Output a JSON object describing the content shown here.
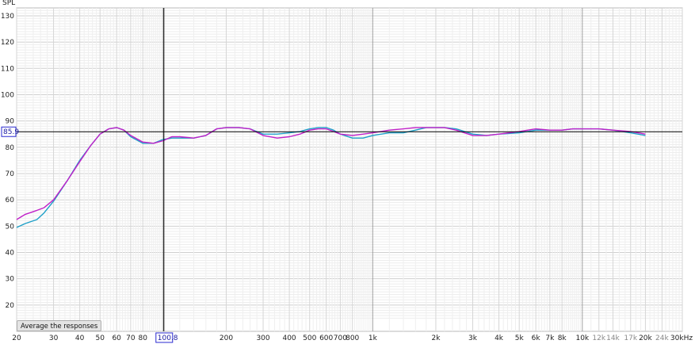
{
  "toolbar": {
    "average_label": "Average the responses"
  },
  "cursor": {
    "spl_readout": "85.9",
    "freq_readout": "100.8",
    "spl_value": 85.9,
    "freq_value": 100.8
  },
  "colors": {
    "series_a": "#1ea0c8",
    "series_b": "#c020c8",
    "cursor": "#000000"
  },
  "chart_data": {
    "type": "line",
    "ylabel": "SPL",
    "xscale": "log",
    "xlim": [
      20,
      30000
    ],
    "ylim": [
      10,
      133
    ],
    "grid": true,
    "x_ticks": [
      {
        "v": 20,
        "label": "20"
      },
      {
        "v": 30,
        "label": "30"
      },
      {
        "v": 40,
        "label": "40"
      },
      {
        "v": 50,
        "label": "50"
      },
      {
        "v": 60,
        "label": "60"
      },
      {
        "v": 70,
        "label": "70"
      },
      {
        "v": 80,
        "label": "80"
      },
      {
        "v": 200,
        "label": "200"
      },
      {
        "v": 300,
        "label": "300"
      },
      {
        "v": 400,
        "label": "400"
      },
      {
        "v": 500,
        "label": "500"
      },
      {
        "v": 600,
        "label": "600"
      },
      {
        "v": 700,
        "label": "700"
      },
      {
        "v": 800,
        "label": "800"
      },
      {
        "v": 1000,
        "label": "1k"
      },
      {
        "v": 2000,
        "label": "2k"
      },
      {
        "v": 3000,
        "label": "3k"
      },
      {
        "v": 4000,
        "label": "4k"
      },
      {
        "v": 5000,
        "label": "5k"
      },
      {
        "v": 6000,
        "label": "6k"
      },
      {
        "v": 7000,
        "label": "7k"
      },
      {
        "v": 8000,
        "label": "8k"
      },
      {
        "v": 10000,
        "label": "10k"
      },
      {
        "v": 12000,
        "label": "12k"
      },
      {
        "v": 14000,
        "label": "14k"
      },
      {
        "v": 17000,
        "label": "17k"
      },
      {
        "v": 20000,
        "label": "20k"
      },
      {
        "v": 24000,
        "label": "24k"
      },
      {
        "v": 30000,
        "label": "30kHz"
      }
    ],
    "y_ticks": [
      20,
      30,
      40,
      50,
      60,
      70,
      80,
      90,
      100,
      110,
      120,
      130
    ],
    "series": [
      {
        "color": "#1ea0c8",
        "x": [
          20,
          22,
          25,
          27,
          30,
          35,
          40,
          45,
          50,
          55,
          60,
          65,
          70,
          80,
          90,
          100,
          110,
          120,
          140,
          160,
          180,
          200,
          230,
          260,
          300,
          350,
          400,
          450,
          500,
          550,
          600,
          650,
          700,
          800,
          900,
          1000,
          1200,
          1400,
          1600,
          1800,
          2000,
          2200,
          2500,
          3000,
          3500,
          4000,
          5000,
          6000,
          7000,
          8000,
          9000,
          10000,
          12000,
          14000,
          17000,
          20000
        ],
        "y": [
          49.5,
          51,
          52.5,
          55,
          59.5,
          67.5,
          75,
          80.5,
          85,
          87,
          87.5,
          86.5,
          84,
          81.5,
          81.5,
          83,
          83.5,
          83.5,
          83.5,
          84.5,
          87,
          87.5,
          87.5,
          87,
          85,
          85,
          85.5,
          86,
          87,
          87.5,
          87.5,
          86.5,
          85,
          83.5,
          83.5,
          84.5,
          85.5,
          85.5,
          86.5,
          87.5,
          87.5,
          87.5,
          87,
          85,
          84.5,
          85,
          85.5,
          86.5,
          86.5,
          86.5,
          87,
          87,
          87,
          86.5,
          85.5,
          84.5
        ]
      },
      {
        "color": "#c020c8",
        "x": [
          20,
          22,
          25,
          27,
          30,
          35,
          40,
          45,
          50,
          55,
          60,
          65,
          70,
          80,
          90,
          100,
          110,
          120,
          140,
          160,
          180,
          200,
          230,
          260,
          300,
          350,
          400,
          450,
          500,
          550,
          600,
          650,
          700,
          800,
          900,
          1000,
          1200,
          1400,
          1600,
          1800,
          2000,
          2200,
          2500,
          3000,
          3500,
          4000,
          5000,
          6000,
          7000,
          8000,
          9000,
          10000,
          12000,
          14000,
          17000,
          20000
        ],
        "y": [
          52.5,
          54.5,
          56,
          57,
          60,
          67.5,
          74.5,
          80.5,
          85,
          87,
          87.5,
          86.5,
          84.5,
          82,
          81.5,
          82.5,
          84,
          84,
          83.5,
          84.5,
          87,
          87.5,
          87.5,
          87,
          84.5,
          83.5,
          84,
          85,
          86.5,
          87,
          87,
          86,
          85,
          84.5,
          85,
          85.5,
          86.5,
          87,
          87.5,
          87.5,
          87.5,
          87.5,
          86.5,
          84.5,
          84.5,
          85,
          86,
          87,
          86.5,
          86.5,
          87,
          87,
          87,
          86.5,
          86,
          85
        ]
      }
    ]
  }
}
